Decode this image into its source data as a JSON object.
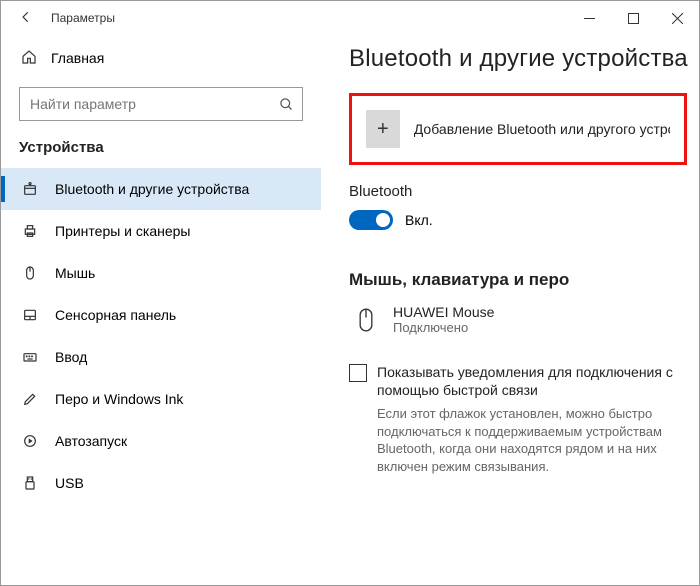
{
  "window": {
    "title": "Параметры"
  },
  "sidebar": {
    "home": "Главная",
    "search_placeholder": "Найти параметр",
    "header": "Устройства",
    "items": [
      {
        "label": "Bluetooth и другие устройства"
      },
      {
        "label": "Принтеры и сканеры"
      },
      {
        "label": "Мышь"
      },
      {
        "label": "Сенсорная панель"
      },
      {
        "label": "Ввод"
      },
      {
        "label": "Перо и Windows Ink"
      },
      {
        "label": "Автозапуск"
      },
      {
        "label": "USB"
      }
    ]
  },
  "content": {
    "title": "Bluetooth и другие устройства",
    "add_device": "Добавление Bluetooth или другого устройс...",
    "bluetooth_label": "Bluetooth",
    "toggle_state": "Вкл.",
    "section_header": "Мышь, клавиатура и перо",
    "device": {
      "name": "HUAWEI  Mouse",
      "status": "Подключено"
    },
    "checkbox_label": "Показывать уведомления для подключения с помощью быстрой связи",
    "helper_text": "Если этот флажок установлен, можно быстро подключаться к поддерживаемым устройствам Bluetooth, когда они находятся рядом и на них включен режим связывания."
  }
}
